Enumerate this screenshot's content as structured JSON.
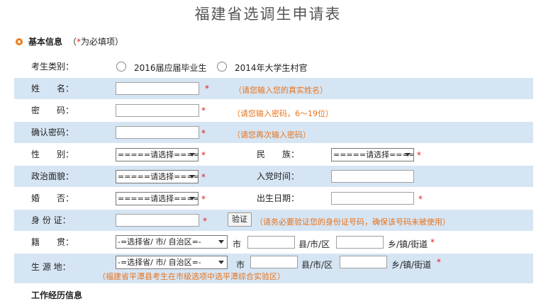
{
  "page": {
    "title": "福建省选调生申请表",
    "section_title": "基本信息",
    "section_note_open": "（",
    "section_note_star": "*",
    "section_note_text": "为必填项）",
    "next_section_partial": "工作经历信息"
  },
  "form": {
    "candidate_type": {
      "label": "考生类别：",
      "option1": "2016届应届毕业生",
      "option2": "2014年大学生村官"
    },
    "name": {
      "label": "姓　　名：",
      "hint": "（请您输入您的真实姓名）"
    },
    "password": {
      "label": "密　　码：",
      "hint": "（请您输入密码，6～19位）"
    },
    "confirm_password": {
      "label": "确认密码：",
      "hint": "（请您再次输入密码）"
    },
    "gender": {
      "label": "性　　别：",
      "selected": "=====请选择===="
    },
    "ethnicity": {
      "label": "民　　族：",
      "selected": "=====请选择===="
    },
    "political_status": {
      "label": "政治面貌：",
      "selected": "=====请选择===="
    },
    "party_join_date": {
      "label": "入党时间："
    },
    "marital_status": {
      "label": "婚　　否：",
      "selected": "=====请选择===="
    },
    "birth_date": {
      "label": "出生日期："
    },
    "id_card": {
      "label": "身 份 证：",
      "verify_button": "验证",
      "hint": "（请务必要验证您的身份证号码，确保该号码未被使用）"
    },
    "native_place": {
      "label": "籍　　贯：",
      "province_selected": "-=选择省/ 市/ 自治区=-",
      "city_suffix": "市",
      "county_suffix": "县/市/区",
      "town_suffix": "乡/镇/街道"
    },
    "origin_place": {
      "label": "生 源 地：",
      "province_selected": "-=选择省/ 市/ 自治区=-",
      "city_suffix": "市",
      "county_suffix": "县/市/区",
      "town_suffix": "乡/镇/街道",
      "hint": "（福建省平潭县考生在市级选项中选平潭综合实验区）"
    },
    "required_mark": "*"
  },
  "colors": {
    "band": "#d6e5f4",
    "hint": "#e8731a",
    "required": "#e02020",
    "bullet": "#f07b16"
  }
}
